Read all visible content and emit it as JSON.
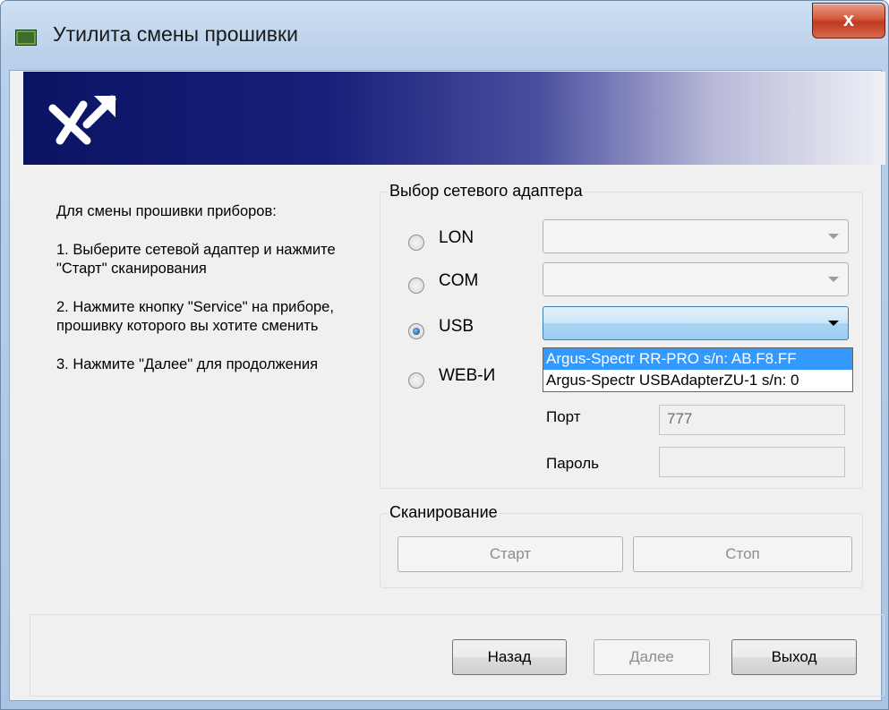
{
  "window": {
    "title": "Утилита смены прошивки",
    "close_label": "x"
  },
  "instructions": {
    "heading": "Для смены прошивки приборов:",
    "step1": "1. Выберите сетевой адаптер и нажмите \"Старт\" сканирования",
    "step2": "2. Нажмите кнопку \"Service\" на приборе, прошивку которого вы хотите сменить",
    "step3": "3. Нажмите \"Далее\" для продолжения"
  },
  "adapter_group": {
    "legend": "Выбор сетевого адаптера",
    "options": [
      {
        "label": "LON",
        "selected": false
      },
      {
        "label": "COM",
        "selected": false
      },
      {
        "label": "USB",
        "selected": true
      },
      {
        "label": "WEB-И",
        "selected": false
      }
    ],
    "usb_dropdown_items": [
      "Argus-Spectr RR-PRO s/n: AB.F8.FF",
      "Argus-Spectr USBAdapterZU-1 s/n: 0"
    ],
    "port_label": "Порт",
    "port_value": "777",
    "password_label": "Пароль",
    "password_value": ""
  },
  "scan_group": {
    "legend": "Сканирование",
    "start_label": "Старт",
    "stop_label": "Стоп"
  },
  "footer": {
    "back_label": "Назад",
    "next_label": "Далее",
    "exit_label": "Выход"
  },
  "colors": {
    "selection": "#3399ff",
    "banner_dark": "#0b1462"
  }
}
